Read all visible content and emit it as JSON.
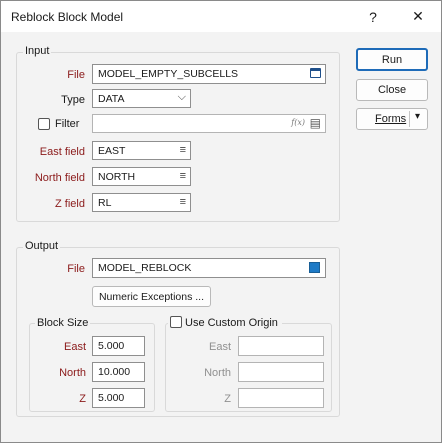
{
  "window": {
    "title": "Reblock Block Model",
    "help": "?",
    "close": "✕"
  },
  "buttons": {
    "run": "Run",
    "close": "Close",
    "forms": "Forms",
    "forms_arrow": "▾"
  },
  "input": {
    "group_label": "Input",
    "file_label": "File",
    "file_value": "MODEL_EMPTY_SUBCELLS",
    "type_label": "Type",
    "type_value": "DATA",
    "filter_label": "Filter",
    "filter_value": "",
    "fx": "f(x)",
    "east_label": "East field",
    "east_value": "EAST",
    "north_label": "North field",
    "north_value": "NORTH",
    "z_label": "Z field",
    "z_value": "RL"
  },
  "output": {
    "group_label": "Output",
    "file_label": "File",
    "file_value": "MODEL_REBLOCK",
    "numeric_exceptions": "Numeric Exceptions ..."
  },
  "block_size": {
    "group_label": "Block Size",
    "east_label": "East",
    "east_value": "5.000",
    "north_label": "North",
    "north_value": "10.000",
    "z_label": "Z",
    "z_value": "5.000"
  },
  "origin": {
    "checkbox_label": "Use Custom Origin",
    "east_label": "East",
    "east_value": "",
    "north_label": "North",
    "north_value": "",
    "z_label": "Z",
    "z_value": ""
  },
  "icons": {
    "list": "≡",
    "chevron": "⌵",
    "table": "▤"
  },
  "colors": {
    "accent": "#1e6bb8",
    "required_label": "#8b1a1a",
    "disabled_label": "#909090"
  }
}
